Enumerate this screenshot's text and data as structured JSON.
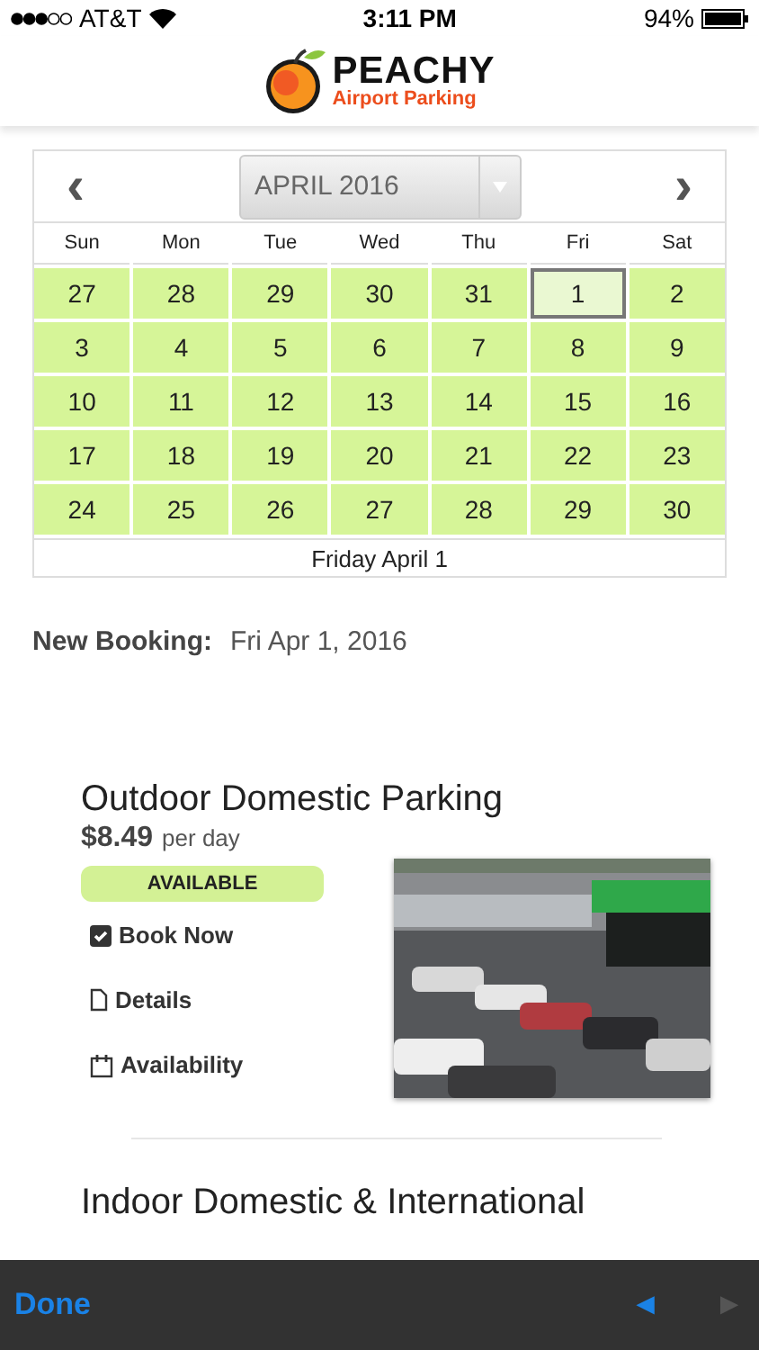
{
  "status_bar": {
    "carrier": "AT&T",
    "time": "3:11 PM",
    "battery": "94%"
  },
  "header": {
    "brand": "PEACHY",
    "tagline": "Airport Parking"
  },
  "calendar": {
    "prev": "‹",
    "month": "APRIL 2016",
    "next": "›",
    "weekdays": [
      "Sun",
      "Mon",
      "Tue",
      "Wed",
      "Thu",
      "Fri",
      "Sat"
    ],
    "weeks": [
      [
        {
          "day": "27",
          "selected": false
        },
        {
          "day": "28",
          "selected": false
        },
        {
          "day": "29",
          "selected": false
        },
        {
          "day": "30",
          "selected": false
        },
        {
          "day": "31",
          "selected": false
        },
        {
          "day": "1",
          "selected": true
        },
        {
          "day": "2",
          "selected": false
        }
      ],
      [
        {
          "day": "3",
          "selected": false
        },
        {
          "day": "4",
          "selected": false
        },
        {
          "day": "5",
          "selected": false
        },
        {
          "day": "6",
          "selected": false
        },
        {
          "day": "7",
          "selected": false
        },
        {
          "day": "8",
          "selected": false
        },
        {
          "day": "9",
          "selected": false
        }
      ],
      [
        {
          "day": "10",
          "selected": false
        },
        {
          "day": "11",
          "selected": false
        },
        {
          "day": "12",
          "selected": false
        },
        {
          "day": "13",
          "selected": false
        },
        {
          "day": "14",
          "selected": false
        },
        {
          "day": "15",
          "selected": false
        },
        {
          "day": "16",
          "selected": false
        }
      ],
      [
        {
          "day": "17",
          "selected": false
        },
        {
          "day": "18",
          "selected": false
        },
        {
          "day": "19",
          "selected": false
        },
        {
          "day": "20",
          "selected": false
        },
        {
          "day": "21",
          "selected": false
        },
        {
          "day": "22",
          "selected": false
        },
        {
          "day": "23",
          "selected": false
        }
      ],
      [
        {
          "day": "24",
          "selected": false
        },
        {
          "day": "25",
          "selected": false
        },
        {
          "day": "26",
          "selected": false
        },
        {
          "day": "27",
          "selected": false
        },
        {
          "day": "28",
          "selected": false
        },
        {
          "day": "29",
          "selected": false
        },
        {
          "day": "30",
          "selected": false
        }
      ]
    ],
    "footer": "Friday April 1"
  },
  "booking": {
    "label": "New Booking:",
    "value": "Fri Apr 1, 2016"
  },
  "listings": [
    {
      "title": "Outdoor Domestic Parking",
      "price": "$8.49",
      "unit": "per day",
      "status": "AVAILABLE",
      "actions": [
        {
          "kind": "book",
          "label": "Book Now"
        },
        {
          "kind": "details",
          "label": "Details"
        },
        {
          "kind": "availability",
          "label": "Availability"
        }
      ]
    },
    {
      "title": "Indoor Domestic & International"
    }
  ],
  "toolbar": {
    "done": "Done",
    "prev": {
      "label": "◄",
      "disabled": false
    },
    "next": {
      "label": "►",
      "disabled": true
    }
  }
}
